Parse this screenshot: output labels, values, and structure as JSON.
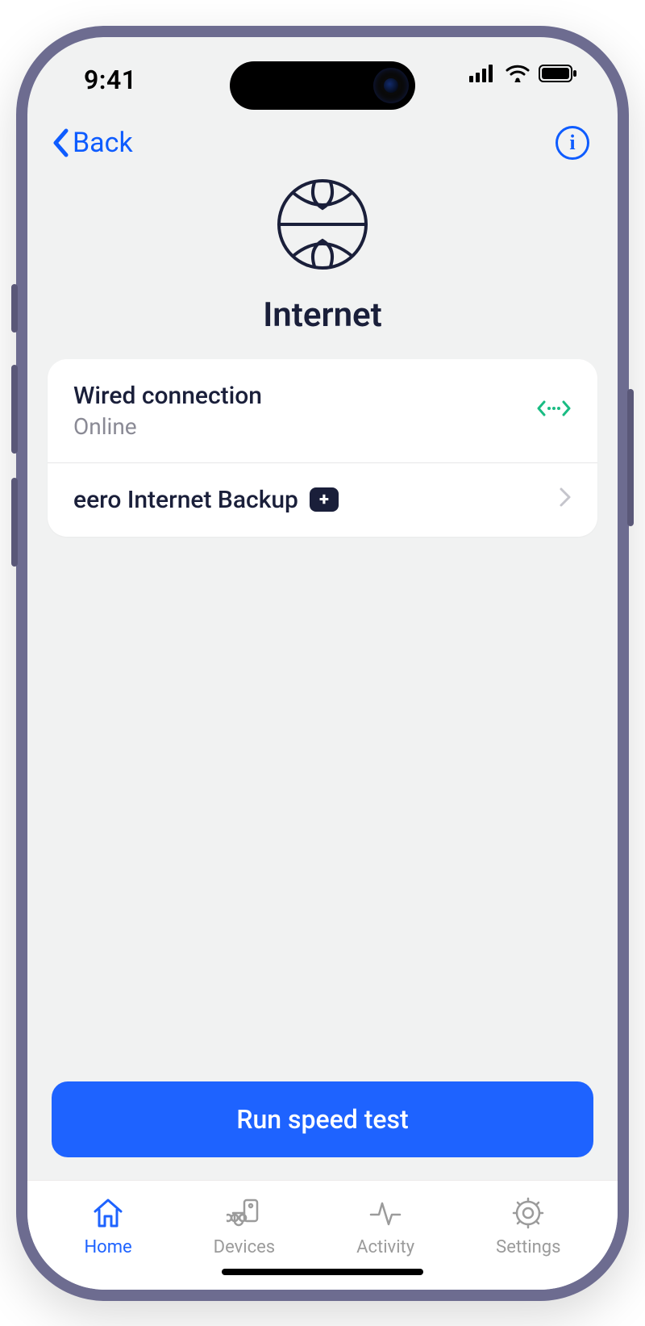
{
  "status": {
    "time": "9:41"
  },
  "nav": {
    "back_label": "Back"
  },
  "page": {
    "title": "Internet"
  },
  "rows": {
    "wired": {
      "title": "Wired connection",
      "status": "Online"
    },
    "backup": {
      "title": "eero Internet Backup"
    }
  },
  "cta": {
    "label": "Run speed test"
  },
  "tabs": {
    "home": "Home",
    "devices": "Devices",
    "activity": "Activity",
    "settings": "Settings"
  }
}
